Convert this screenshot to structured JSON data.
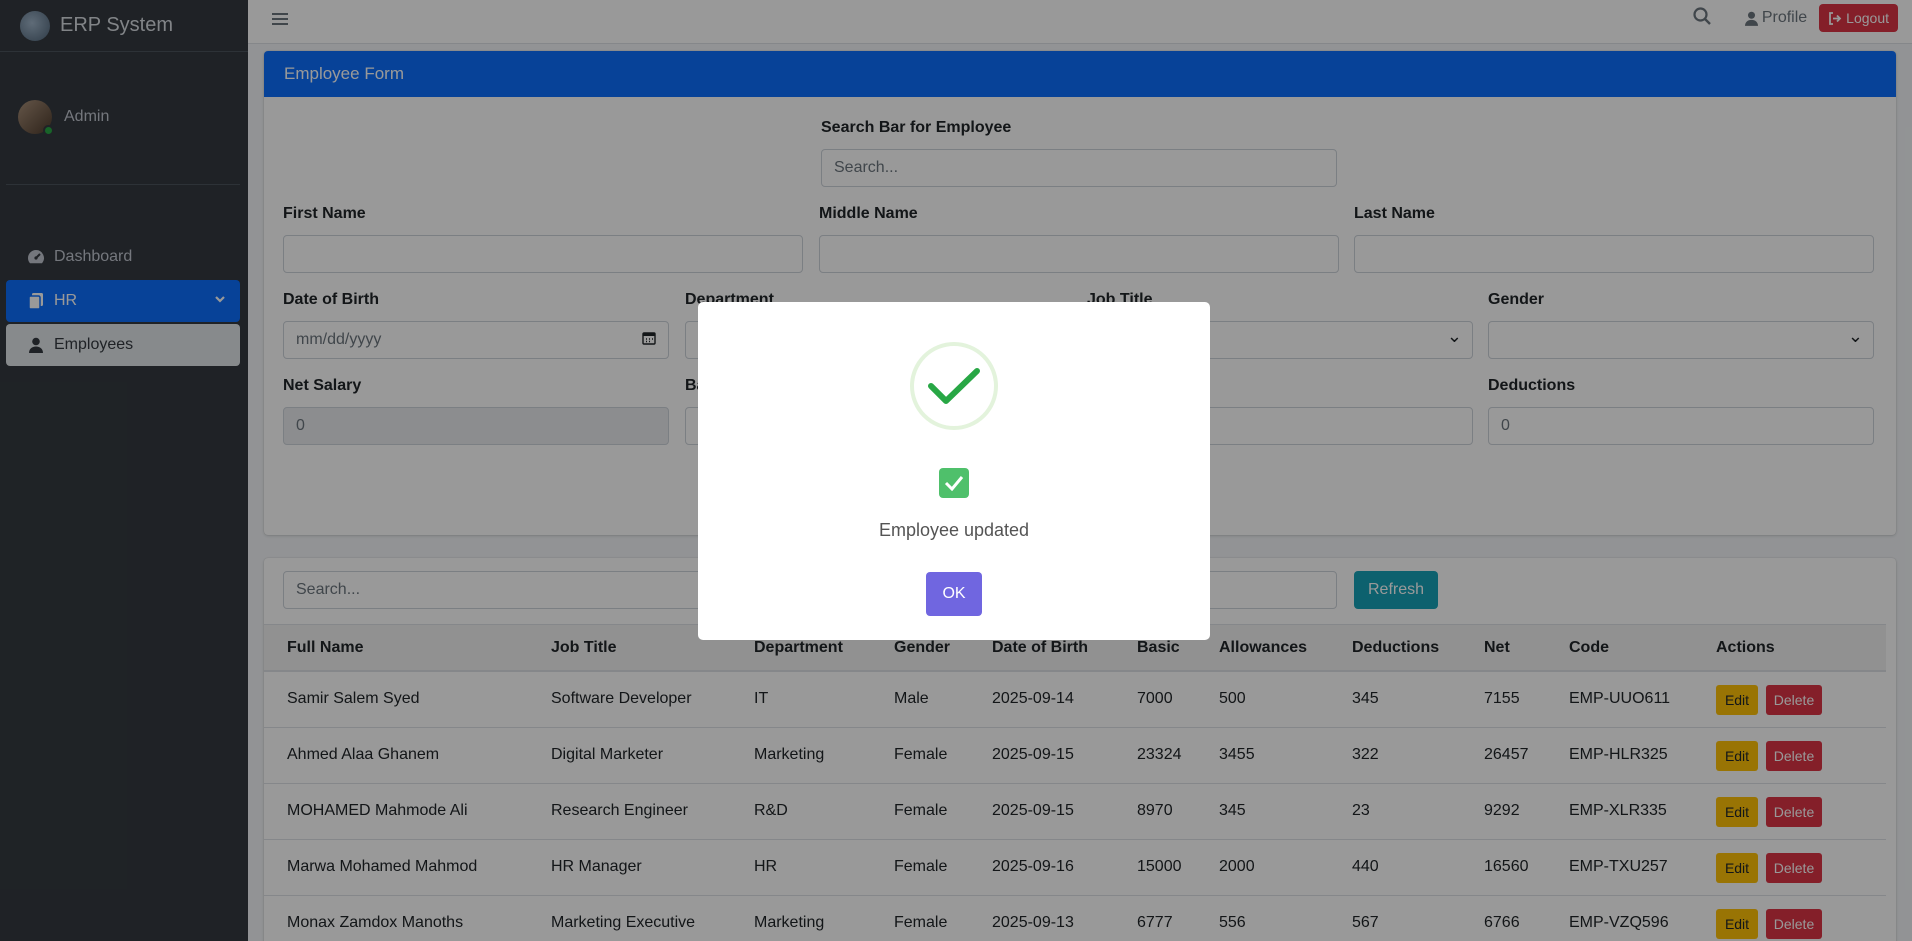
{
  "brand": {
    "name": "ERP System"
  },
  "user": {
    "name": "Admin"
  },
  "nav": {
    "dashboard": "Dashboard",
    "hr": "HR",
    "employees": "Employees"
  },
  "topbar": {
    "profile": "Profile",
    "logout": "Logout"
  },
  "form": {
    "header": "Employee Form",
    "search_label": "Search Bar for Employee",
    "search_placeholder": "Search...",
    "first_name": "First Name",
    "middle_name": "Middle Name",
    "last_name": "Last Name",
    "dob": "Date of Birth",
    "dob_placeholder": "mm/dd/yyyy",
    "department": "Department",
    "job_title": "Job Title",
    "gender": "Gender",
    "net_salary": "Net Salary",
    "net_salary_value": "0",
    "basic_partial": "Ba",
    "deductions": "Deductions",
    "deductions_value": "0"
  },
  "table": {
    "search_placeholder": "Search...",
    "refresh": "Refresh",
    "columns": [
      "Full Name",
      "Job Title",
      "Department",
      "Gender",
      "Date of Birth",
      "Basic",
      "Allowances",
      "Deductions",
      "Net",
      "Code",
      "Actions"
    ],
    "edit": "Edit",
    "delete": "Delete",
    "rows": [
      [
        "Samir Salem Syed",
        "Software Developer",
        "IT",
        "Male",
        "2025-09-14",
        "7000",
        "500",
        "345",
        "7155",
        "EMP-UUO611"
      ],
      [
        "Ahmed Alaa Ghanem",
        "Digital Marketer",
        "Marketing",
        "Female",
        "2025-09-15",
        "23324",
        "3455",
        "322",
        "26457",
        "EMP-HLR325"
      ],
      [
        "MOHAMED Mahmode Ali",
        "Research Engineer",
        "R&D",
        "Female",
        "2025-09-15",
        "8970",
        "345",
        "23",
        "9292",
        "EMP-XLR335"
      ],
      [
        "Marwa Mohamed Mahmod",
        "HR Manager",
        "HR",
        "Female",
        "2025-09-16",
        "15000",
        "2000",
        "440",
        "16560",
        "EMP-TXU257"
      ],
      [
        "Monax Zamdox Manoths",
        "Marketing Executive",
        "Marketing",
        "Female",
        "2025-09-13",
        "6777",
        "556",
        "567",
        "6766",
        "EMP-VZQ596"
      ]
    ]
  },
  "modal": {
    "message": "Employee updated",
    "ok": "OK"
  },
  "colors": {
    "primary": "#0d6efd",
    "danger": "#dc3545",
    "info": "#17a2b8",
    "warning": "#ffc107",
    "success": "#4fc06b",
    "confirm": "#7066e0",
    "sidebar": "#343a40"
  }
}
